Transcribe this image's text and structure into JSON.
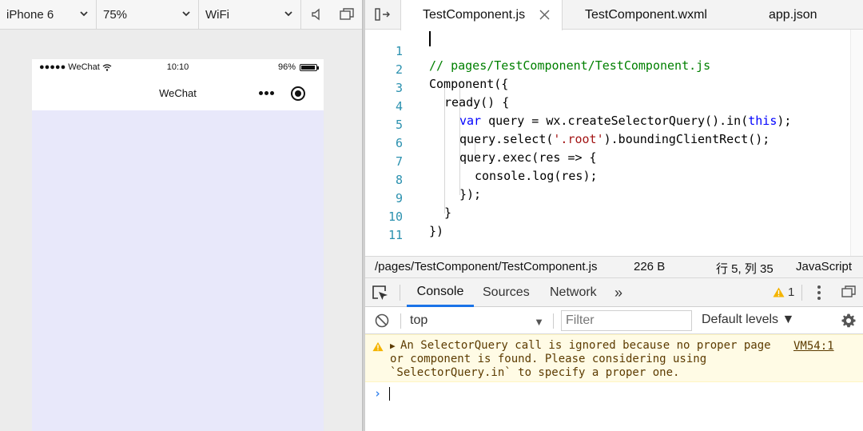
{
  "device_toolbar": {
    "device": "iPhone 6",
    "zoom": "75%",
    "network": "WiFi"
  },
  "phone": {
    "carrier": "●●●●● WeChat",
    "time": "10:10",
    "battery": "96%",
    "battery_level": 0.96,
    "nav_title": "WeChat",
    "background_color": "#e8e8fa"
  },
  "editor": {
    "tabs": [
      {
        "label": "TestComponent.js",
        "active": true
      },
      {
        "label": "TestComponent.wxml",
        "active": false
      },
      {
        "label": "app.json",
        "active": false
      }
    ],
    "line_numbers": [
      "1",
      "2",
      "3",
      "4",
      "5",
      "6",
      "7",
      "8",
      "9",
      "10",
      "11"
    ],
    "code": {
      "l1": "// pages/TestComponent/TestComponent.js",
      "l2": "Component({",
      "l3": "ready() {",
      "l4_kw": "var",
      "l4_a": " query = wx.createSelectorQuery().in(",
      "l4_kw2": "this",
      "l4_b": ");",
      "l5_a": "query.select(",
      "l5_str": "'.root'",
      "l5_b": ").boundingClientRect();",
      "l6": "query.exec(res => {",
      "l7": "console.log(res);",
      "l8": "});",
      "l9": "}",
      "l10": "})"
    }
  },
  "editor_status": {
    "path": "/pages/TestComponent/TestComponent.js",
    "size": "226 B",
    "position": "行 5, 列 35",
    "language": "JavaScript"
  },
  "devtools": {
    "tabs": [
      "Console",
      "Sources",
      "Network",
      "»"
    ],
    "active_tab": "Console",
    "warning_count": "1",
    "context": "top",
    "filter_placeholder": "Filter",
    "levels": "Default levels ▼",
    "message": {
      "line1": "An SelectorQuery call is ignored because no proper page",
      "line2": "or component is found. Please considering using",
      "line3": "`SelectorQuery.in` to specify a proper one.",
      "source": "VM54:1"
    },
    "prompt": "›"
  },
  "colors": {
    "accent": "#1a73e8",
    "warning": "#f4b400",
    "comment": "#008000",
    "keyword": "#0000ff",
    "string": "#a31515",
    "line_number": "#2b91af"
  }
}
